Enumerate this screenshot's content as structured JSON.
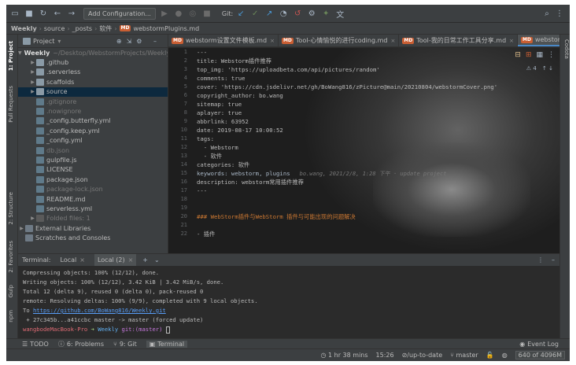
{
  "toolbar": {
    "run_config": "Add Configuration...",
    "git_label": "Git:"
  },
  "breadcrumb": [
    "Weekly",
    "source",
    "_posts",
    "软件",
    "webstormPlugins.md"
  ],
  "left_tabs": {
    "project": "1: Project",
    "pull_requests": "Pull Requests",
    "structure": "2: Structure",
    "favorites": "2: Favorites",
    "gulp": "Gulp",
    "npm": "npm"
  },
  "right_tab": "Codota",
  "project": {
    "header": "Project",
    "root": {
      "name": "Weekly",
      "path": "~/Desktop/WebstormProjects/Weekly"
    },
    "items": [
      {
        "name": ".github",
        "type": "folder"
      },
      {
        "name": ".serverless",
        "type": "folder"
      },
      {
        "name": "scaffolds",
        "type": "folder"
      },
      {
        "name": "source",
        "type": "folder"
      },
      {
        "name": ".gitignore",
        "type": "file"
      },
      {
        "name": ".nowignore",
        "type": "file"
      },
      {
        "name": "_config.butterfly.yml",
        "type": "file"
      },
      {
        "name": "_config.keep.yml",
        "type": "file"
      },
      {
        "name": "_config.yml",
        "type": "file"
      },
      {
        "name": "db.json",
        "type": "file"
      },
      {
        "name": "gulpfile.js",
        "type": "file"
      },
      {
        "name": "LICENSE",
        "type": "file"
      },
      {
        "name": "package.json",
        "type": "file"
      },
      {
        "name": "package-lock.json",
        "type": "file"
      },
      {
        "name": "README.md",
        "type": "file"
      },
      {
        "name": "serverless.yml",
        "type": "file"
      },
      {
        "name": "Folded files: 1",
        "type": "folded"
      },
      {
        "name": "External Libraries",
        "type": "lib"
      },
      {
        "name": "Scratches and Consoles",
        "type": "scratch"
      }
    ]
  },
  "tabs": [
    {
      "label": "webstorm设置文件模板.md",
      "active": false
    },
    {
      "label": "Tool-心情愉悦的进行coding.md",
      "active": false
    },
    {
      "label": "Tool-我的日常工作工具分享.md",
      "active": false
    },
    {
      "label": "webstormPlugins.md",
      "active": true
    }
  ],
  "editor": {
    "line_numbers": [
      "1",
      "2",
      "3",
      "4",
      "5",
      "6",
      "7",
      "8",
      "9",
      "10",
      "11",
      "12",
      "13",
      "14",
      "15",
      "16",
      "17",
      "18",
      "19",
      "20",
      "21",
      "22"
    ],
    "lines": [
      "---",
      "title: Webstorm插件推荐",
      "top_img: 'https://uploadbeta.com/api/pictures/random'",
      "comments: true",
      "cover: 'https://cdn.jsdelivr.net/gh/BoWang816/zPicture@main/20210804/webstormCover.png'",
      "copyright_author: bo.wang",
      "sitemap: true",
      "aplayer: true",
      "abbrlink: 63952",
      "date: 2019-08-17 10:00:52",
      "tags:",
      "  - Webstorm",
      "  - 软件",
      "categories: 软件",
      "keywords: webstorm, plugins",
      "description: webstorm常用插件推荐",
      "---",
      "",
      "",
      "### WebStorm插件与WebStorm 插件与可能出现的问题解决",
      "",
      "- 插件"
    ],
    "blame": "bo.wang, 2021/2/8, 1:28 下午 · update project",
    "inspection_count": "4"
  },
  "terminal": {
    "label": "Terminal:",
    "tabs": [
      "Local",
      "Local (2)"
    ],
    "lines": [
      "Compressing objects: 100% (12/12), done.",
      "Writing objects: 100% (12/12), 3.42 KiB | 3.42 MiB/s, done.",
      "Total 12 (delta 9), reused 0 (delta 0), pack-reused 0",
      "remote: Resolving deltas: 100% (9/9), completed with 9 local objects.",
      "To ",
      " + 27c345b...a41ccbc master -> master (forced update)"
    ],
    "repo_url": "https://github.com/BoWang816/Weekly.git",
    "prompt": {
      "user": "wangbodeMacBook-Pro",
      "dir": "Weekly",
      "git": "git:(master)"
    }
  },
  "bottom_tools": [
    "TODO",
    "6: Problems",
    "9: Git",
    "Terminal"
  ],
  "event_log": "Event Log",
  "status": {
    "time": "1 hr 38 mins",
    "pos": "15:26",
    "vcs": "up-to-date",
    "branch": "master",
    "memory": "640 of 4096M"
  }
}
